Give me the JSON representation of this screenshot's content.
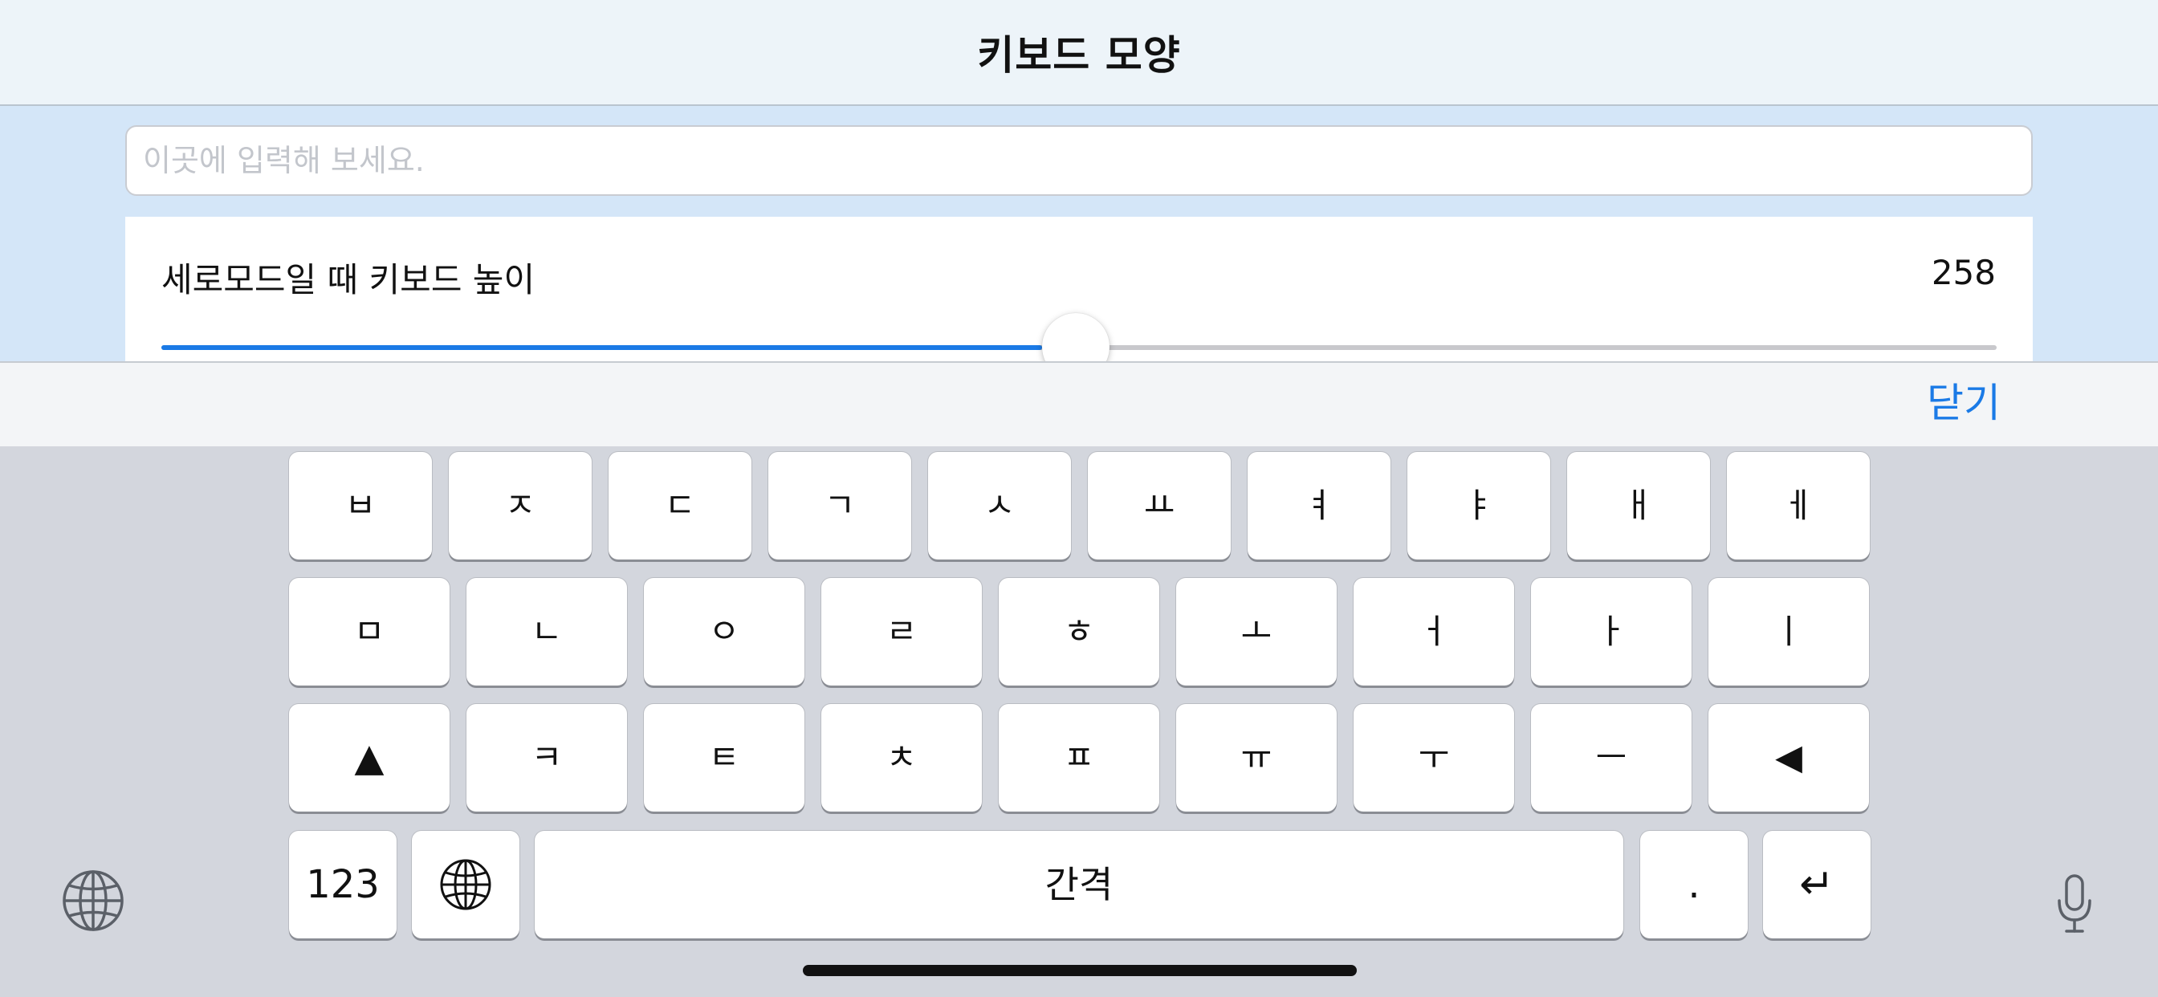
{
  "navbar": {
    "title": "키보드 모양"
  },
  "input": {
    "placeholder": "이곳에 입력해 보세요."
  },
  "setting": {
    "label": "세로모드일 때 키보드 높이",
    "value": "258",
    "slider_fraction": 0.48
  },
  "accessory": {
    "close_label": "닫기"
  },
  "keyboard": {
    "row1": [
      "ㅂ",
      "ㅈ",
      "ㄷ",
      "ㄱ",
      "ㅅ",
      "ㅛ",
      "ㅕ",
      "ㅑ",
      "ㅐ",
      "ㅔ"
    ],
    "row2": [
      "ㅁ",
      "ㄴ",
      "ㅇ",
      "ㄹ",
      "ㅎ",
      "ㅗ",
      "ㅓ",
      "ㅏ",
      "ㅣ"
    ],
    "row3": [
      "▲",
      "ㅋ",
      "ㅌ",
      "ㅊ",
      "ㅍ",
      "ㅠ",
      "ㅜ",
      "ㅡ",
      "◀"
    ],
    "numbers_label": "123",
    "space_label": "간격",
    "period_label": ".",
    "return_label": "↵"
  },
  "icons": {
    "globe": "globe-icon",
    "microphone": "microphone-icon"
  },
  "colors": {
    "accent": "#1a7ae6",
    "content_bg": "#d4e6f8",
    "keyboard_bg": "#d3d6dd"
  }
}
